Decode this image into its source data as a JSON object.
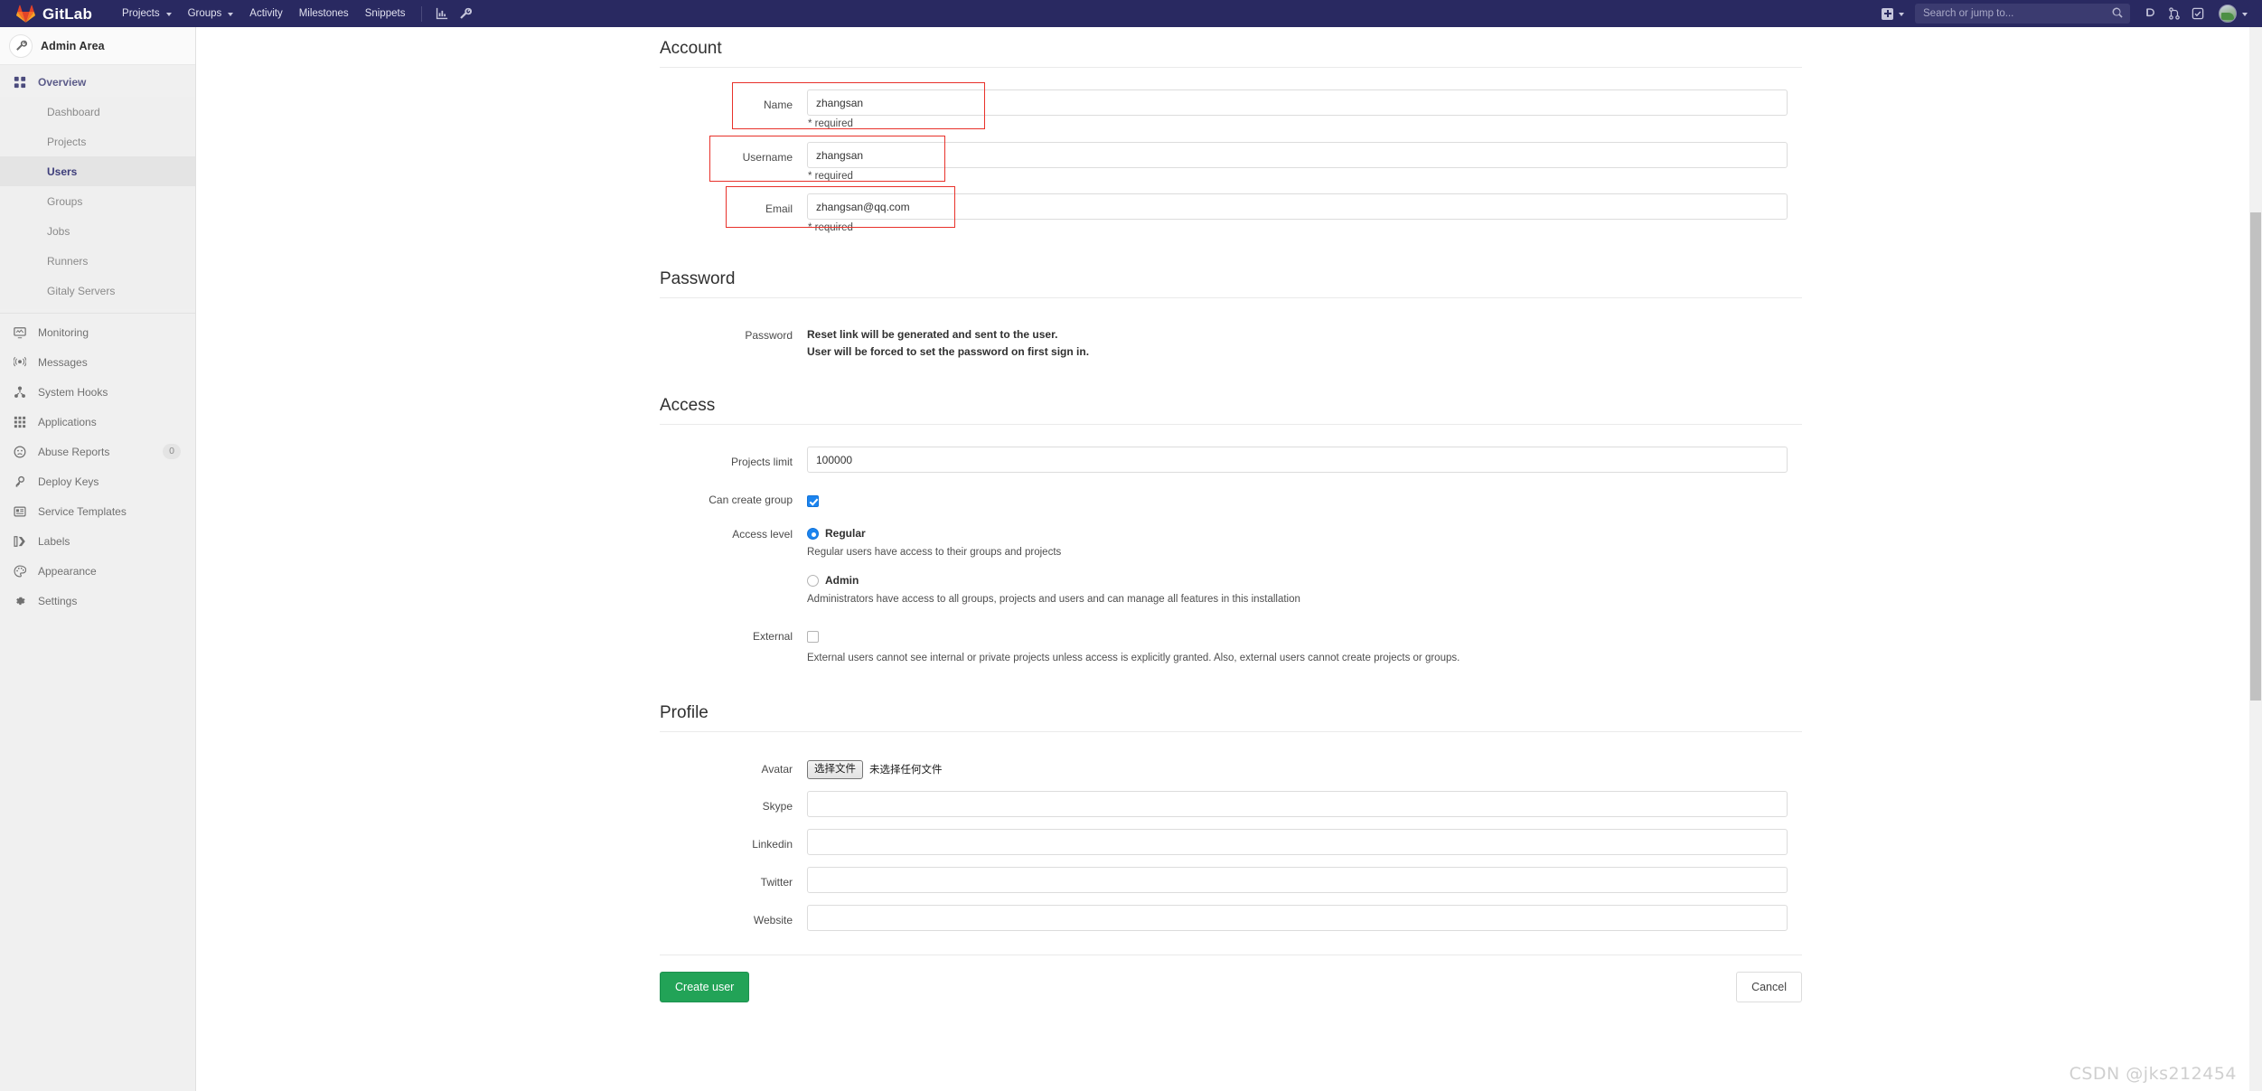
{
  "navbar": {
    "brand": "GitLab",
    "links": [
      {
        "label": "Projects",
        "has_caret": true,
        "icon": "none"
      },
      {
        "label": "Groups",
        "has_caret": true,
        "icon": "none"
      },
      {
        "label": "Activity",
        "has_caret": false,
        "icon": "none"
      },
      {
        "label": "Milestones",
        "has_caret": false,
        "icon": "none"
      },
      {
        "label": "Snippets",
        "has_caret": false,
        "icon": "none"
      }
    ],
    "icon_buttons": [
      {
        "name": "analytics-chart-icon"
      },
      {
        "name": "wrench-admin-icon"
      }
    ],
    "new_dropdown_label": "+",
    "search": {
      "placeholder": "Search or jump to...",
      "value": ""
    },
    "right_icons": [
      {
        "name": "issues-icon"
      },
      {
        "name": "merge-request-icon"
      },
      {
        "name": "todos-checkmark-icon"
      }
    ],
    "user_menu_label": ""
  },
  "sidebar": {
    "header_title": "Admin Area",
    "header_icon": "wrench-icon",
    "overview": {
      "label": "Overview",
      "icon": "grid-overview-icon"
    },
    "overview_children": [
      {
        "label": "Dashboard",
        "active": false
      },
      {
        "label": "Projects",
        "active": false
      },
      {
        "label": "Users",
        "active": true
      },
      {
        "label": "Groups",
        "active": false
      },
      {
        "label": "Jobs",
        "active": false
      },
      {
        "label": "Runners",
        "active": false
      },
      {
        "label": "Gitaly Servers",
        "active": false
      }
    ],
    "items": [
      {
        "label": "Monitoring",
        "icon": "monitor-icon",
        "badge": ""
      },
      {
        "label": "Messages",
        "icon": "broadcast-icon",
        "badge": ""
      },
      {
        "label": "System Hooks",
        "icon": "hook-icon",
        "badge": ""
      },
      {
        "label": "Applications",
        "icon": "applications-grid-icon",
        "badge": ""
      },
      {
        "label": "Abuse Reports",
        "icon": "abuse-face-icon",
        "badge": "0"
      },
      {
        "label": "Deploy Keys",
        "icon": "key-icon",
        "badge": ""
      },
      {
        "label": "Service Templates",
        "icon": "template-icon",
        "badge": ""
      },
      {
        "label": "Labels",
        "icon": "labels-icon",
        "badge": ""
      },
      {
        "label": "Appearance",
        "icon": "palette-icon",
        "badge": ""
      },
      {
        "label": "Settings",
        "icon": "gear-icon",
        "badge": ""
      }
    ]
  },
  "form": {
    "sections": {
      "account": "Account",
      "password": "Password",
      "access": "Access",
      "profile": "Profile"
    },
    "account": {
      "name_label": "Name",
      "name_value": "zhangsan",
      "name_required": "* required",
      "username_label": "Username",
      "username_value": "zhangsan",
      "username_required": "* required",
      "email_label": "Email",
      "email_value": "zhangsan@qq.com",
      "email_required": "* required"
    },
    "password": {
      "label": "Password",
      "line1": "Reset link will be generated and sent to the user.",
      "line2": "User will be forced to set the password on first sign in."
    },
    "access": {
      "projects_limit_label": "Projects limit",
      "projects_limit_value": "100000",
      "can_create_group_label": "Can create group",
      "can_create_group_checked": true,
      "access_level_label": "Access level",
      "regular_label": "Regular",
      "regular_checked": true,
      "regular_help": "Regular users have access to their groups and projects",
      "admin_label": "Admin",
      "admin_checked": false,
      "admin_help": "Administrators have access to all groups, projects and users and can manage all features in this installation",
      "external_label": "External",
      "external_checked": false,
      "external_help": "External users cannot see internal or private projects unless access is explicitly granted. Also, external users cannot create projects or groups."
    },
    "profile": {
      "avatar_label": "Avatar",
      "avatar_button": "选择文件",
      "avatar_filename": "未选择任何文件",
      "skype_label": "Skype",
      "skype_value": "",
      "linkedin_label": "Linkedin",
      "linkedin_value": "",
      "twitter_label": "Twitter",
      "twitter_value": "",
      "website_label": "Website",
      "website_value": ""
    },
    "actions": {
      "submit": "Create user",
      "cancel": "Cancel"
    }
  },
  "watermark": "CSDN @jks212454",
  "colors": {
    "navbar_bg": "#292961",
    "accent_link": "#4b4b7d",
    "primary_button": "#22a357",
    "annotation_red": "#e8312a",
    "checkbox_blue": "#1b84ef"
  }
}
